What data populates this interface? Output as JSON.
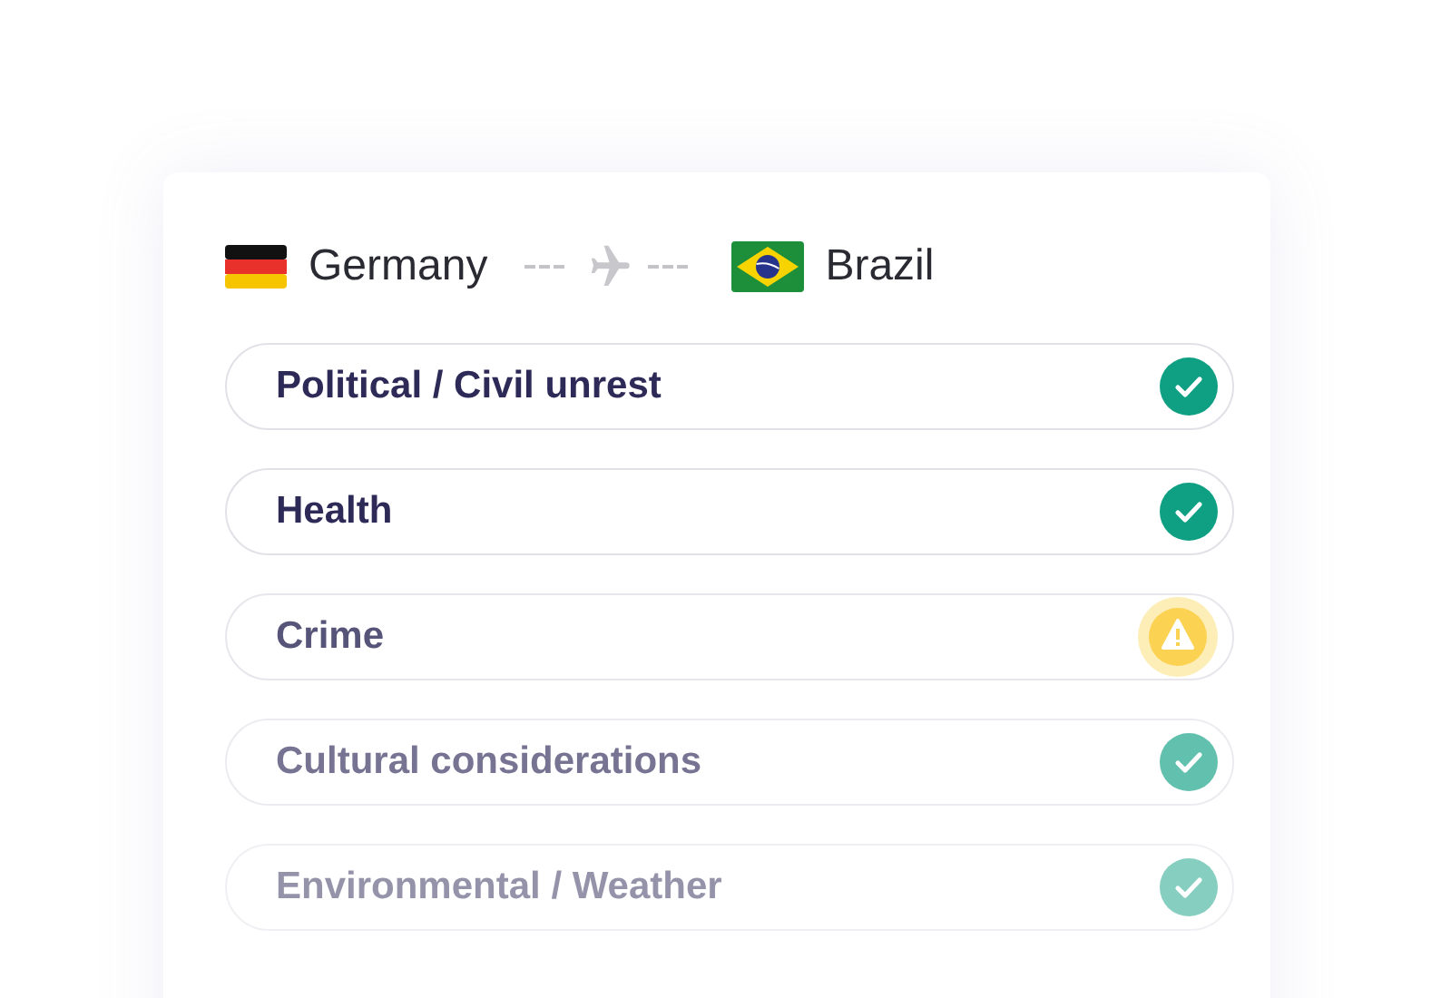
{
  "route": {
    "origin": {
      "country": "Germany"
    },
    "destination": {
      "country": "Brazil"
    }
  },
  "risks": [
    {
      "label": "Political / Civil unrest",
      "kind": "ok"
    },
    {
      "label": "Health",
      "kind": "ok"
    },
    {
      "label": "Crime",
      "kind": "warning"
    },
    {
      "label": "Cultural considerations",
      "kind": "ok"
    },
    {
      "label": "Environmental / Weather",
      "kind": "ok"
    }
  ]
}
